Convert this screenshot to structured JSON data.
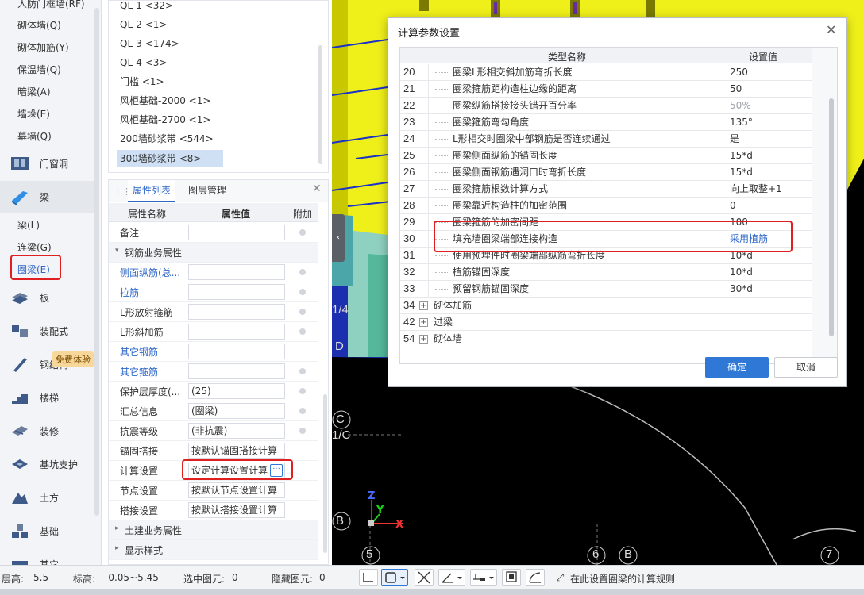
{
  "left_nav": {
    "top_items": [
      "人防门框墙(RF)",
      "砌体墙(Q)",
      "砌体加筋(Y)",
      "保温墙(Q)",
      "暗梁(A)",
      "墙垛(E)",
      "幕墙(Q)"
    ],
    "categories": [
      {
        "label": "门窗洞",
        "icon": "door-window-icon"
      },
      {
        "label": "梁",
        "icon": "beam-icon"
      }
    ],
    "beam_items": [
      "梁(L)",
      "连梁(G)",
      "圈梁(E)"
    ],
    "categories2": [
      {
        "label": "板",
        "icon": "slab-icon"
      },
      {
        "label": "装配式",
        "icon": "prefab-icon"
      },
      {
        "label": "钢结构",
        "icon": "steel-icon"
      },
      {
        "label": "楼梯",
        "icon": "stairs-icon"
      },
      {
        "label": "装修",
        "icon": "decoration-icon"
      },
      {
        "label": "基坑支护",
        "icon": "excavation-icon"
      },
      {
        "label": "土方",
        "icon": "earthwork-icon"
      },
      {
        "label": "基础",
        "icon": "foundation-icon"
      },
      {
        "label": "其它",
        "icon": "other-icon"
      }
    ],
    "free_trial_badge": "免费体验"
  },
  "component_list": {
    "items": [
      "QL-1 <32>",
      "QL-2 <1>",
      "QL-3 <174>",
      "QL-4 <3>",
      "门槛 <1>",
      "风柜基础-2000 <1>",
      "风柜基础-2700 <1>",
      "200墙砂浆带 <544>",
      "300墙砂浆带 <8>"
    ],
    "selected_index": 8
  },
  "properties": {
    "tabs": [
      "属性列表",
      "图层管理"
    ],
    "headers": [
      "属性名称",
      "属性值",
      "附加"
    ],
    "rows": [
      {
        "name": "备注",
        "value": "",
        "dot": true,
        "blue": false
      },
      {
        "group": "钢筋业务属性"
      },
      {
        "name": "侧面纵筋(总...",
        "value": "",
        "dot": true,
        "blue": true
      },
      {
        "name": "拉筋",
        "value": "",
        "dot": true,
        "blue": true
      },
      {
        "name": "L形放射箍筋",
        "value": "",
        "dot": true,
        "blue": false
      },
      {
        "name": "L形斜加筋",
        "value": "",
        "dot": true,
        "blue": false
      },
      {
        "name": "其它钢筋",
        "value": "",
        "dot": false,
        "blue": true
      },
      {
        "name": "其它箍筋",
        "value": "",
        "dot": true,
        "blue": true
      },
      {
        "name": "保护层厚度(...",
        "value": "(25)",
        "dot": true,
        "blue": false
      },
      {
        "name": "汇总信息",
        "value": "(圈梁)",
        "dot": true,
        "blue": false
      },
      {
        "name": "抗震等级",
        "value": "(非抗震)",
        "dot": true,
        "blue": false
      },
      {
        "name": "锚固搭接",
        "value": "按默认锚固搭接计算",
        "dot": false,
        "blue": false
      },
      {
        "name": "计算设置",
        "value": "设定计算设置计算",
        "dot": false,
        "blue": false
      },
      {
        "name": "节点设置",
        "value": "按默认节点设置计算",
        "dot": false,
        "blue": false
      },
      {
        "name": "搭接设置",
        "value": "按默认搭接设置计算",
        "dot": false,
        "blue": false
      },
      {
        "group": "土建业务属性"
      },
      {
        "group": "显示样式"
      }
    ]
  },
  "dialog": {
    "title": "计算参数设置",
    "headers": [
      "类型名称",
      "设置值"
    ],
    "rows": [
      {
        "num": "20",
        "name": "圈梁L形相交斜加筋弯折长度",
        "value": "250"
      },
      {
        "num": "21",
        "name": "圈梁箍筋距构造柱边缘的距离",
        "value": "50"
      },
      {
        "num": "22",
        "name": "圈梁纵筋搭接接头错开百分率",
        "value": "50%",
        "gray": true
      },
      {
        "num": "23",
        "name": "圈梁箍筋弯勾角度",
        "value": "135°"
      },
      {
        "num": "24",
        "name": "L形相交时圈梁中部钢筋是否连续通过",
        "value": "是"
      },
      {
        "num": "25",
        "name": "圈梁侧面纵筋的锚固长度",
        "value": "15*d"
      },
      {
        "num": "26",
        "name": "圈梁侧面钢筋遇洞口时弯折长度",
        "value": "15*d"
      },
      {
        "num": "27",
        "name": "圈梁箍筋根数计算方式",
        "value": "向上取整+1"
      },
      {
        "num": "28",
        "name": "圈梁靠近构造柱的加密范围",
        "value": "0"
      },
      {
        "num": "29",
        "name": "圈梁箍筋的加密间距",
        "value": "100"
      },
      {
        "num": "30",
        "name": "填充墙圈梁端部连接构造",
        "value": "采用植筋",
        "blue": true
      },
      {
        "num": "31",
        "name": "使用预埋件时圈梁端部纵筋弯折长度",
        "value": "10*d"
      },
      {
        "num": "32",
        "name": "植筋锚固深度",
        "value": "10*d"
      },
      {
        "num": "33",
        "name": "预留钢筋锚固深度",
        "value": "30*d"
      }
    ],
    "groups": [
      {
        "num": "34",
        "name": "砌体加筋"
      },
      {
        "num": "42",
        "name": "过梁"
      },
      {
        "num": "54",
        "name": "砌体墙"
      }
    ],
    "ok_label": "确定",
    "cancel_label": "取消"
  },
  "cad": {
    "labels": [
      "1/4",
      "D",
      "C",
      "1/C",
      "B",
      "5",
      "6",
      "B",
      "7"
    ],
    "axis_labels": [
      "Z",
      "Y",
      "X"
    ]
  },
  "status_bar": {
    "floor_height_label": "层高:",
    "floor_height": "5.5",
    "elevation_label": "标高:",
    "elevation": "-0.05~5.45",
    "selected_label": "选中图元:",
    "selected": "0",
    "hidden_label": "隐藏图元:",
    "hidden": "0",
    "hint": "在此设置圈梁的计算规则"
  },
  "colors": {
    "accent": "#2f68c9",
    "highlight": "#e02020",
    "cad_yellow": "#f4f400",
    "cad_blue": "#1a32c8"
  }
}
